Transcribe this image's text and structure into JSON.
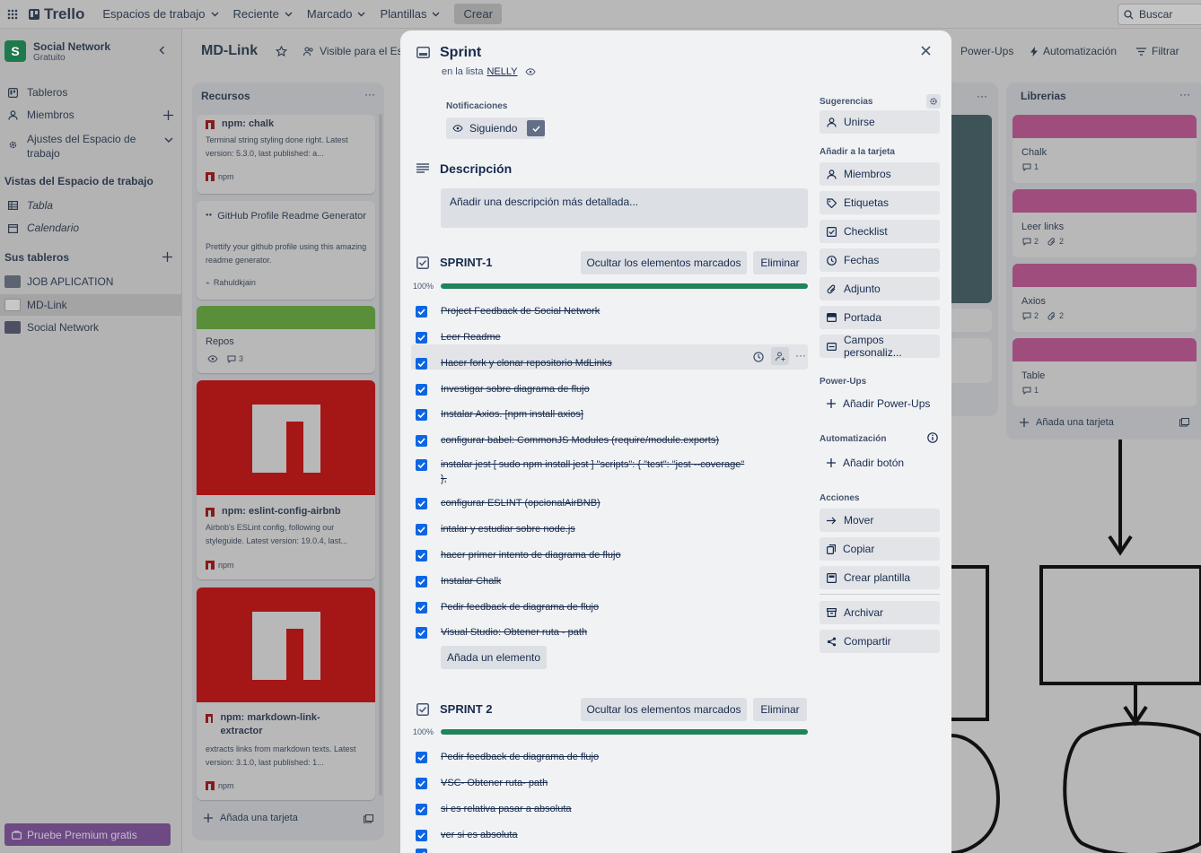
{
  "topbar": {
    "logo": "Trello",
    "nav": [
      "Espacios de trabajo",
      "Reciente",
      "Marcado",
      "Plantillas"
    ],
    "create_label": "Crear",
    "search_placeholder": "Buscar"
  },
  "sidebar": {
    "workspace_name": "Social Network",
    "workspace_plan": "Gratuito",
    "workspace_initial": "S",
    "items": [
      {
        "label": "Tableros",
        "icon": "board-icon"
      },
      {
        "label": "Miembros",
        "icon": "person-icon"
      },
      {
        "label": "Ajustes del Espacio de trabajo",
        "icon": "gear-icon"
      }
    ],
    "views_heading": "Vistas del Espacio de trabajo",
    "views": [
      {
        "label": "Tabla",
        "icon": "table-icon"
      },
      {
        "label": "Calendario",
        "icon": "calendar-icon"
      }
    ],
    "boards_heading": "Sus tableros",
    "boards": [
      "JOB APLICATION",
      "MD-Link",
      "Social Network"
    ],
    "premium_label": "Pruebe Premium gratis"
  },
  "board": {
    "title": "MD-Link",
    "visibility": "Visible para el Esp",
    "powerups": "Power-Ups",
    "automation": "Automatización",
    "filter": "Filtrar"
  },
  "lists": {
    "recursos": {
      "title": "Recursos",
      "chalk": {
        "title": "npm: chalk",
        "desc": "Terminal string styling done right. Latest version: 5.3.0, last published: a...",
        "source": "npm"
      },
      "github": {
        "title": "GitHub Profile Readme Generator",
        "desc": "Prettify your github profile using this amazing readme generator.",
        "author": "Rahuldkjain"
      },
      "repos": {
        "title": "Repos",
        "comments": "3",
        "color": "#5a8f3a"
      },
      "eslint": {
        "title": "npm: eslint-config-airbnb",
        "desc": "Airbnb's ESLint config, following our styleguide. Latest version: 19.0.4, last...",
        "source": "npm"
      },
      "mdlink": {
        "title": "npm: markdown-link-extractor",
        "desc": "extracts links from markdown texts. Latest version: 3.1.0, last published: 1...",
        "source": "npm"
      },
      "add": "Añada una tarjeta"
    },
    "librerias": {
      "title": "Librerias",
      "cards": [
        {
          "title": "Chalk",
          "comments": "1",
          "attachments": ""
        },
        {
          "title": "Leer links",
          "comments": "2",
          "attachments": "2"
        },
        {
          "title": "Axios",
          "comments": "2",
          "attachments": "2"
        },
        {
          "title": "Table",
          "comments": "1",
          "attachments": ""
        }
      ],
      "add": "Añada una tarjeta"
    }
  },
  "modal": {
    "title": "Sprint",
    "list_prefix": "en la lista",
    "list_name": "NELLY",
    "notifications_label": "Notificaciones",
    "following_label": "Siguiendo",
    "description_heading": "Descripción",
    "description_placeholder": "Añadir una descripción más detallada...",
    "checklists": [
      {
        "title": "SPRINT-1",
        "hide_label": "Ocultar los elementos marcados",
        "delete_label": "Eliminar",
        "progress_text": "100%",
        "progress": 1.0,
        "items": [
          "Project Feedback de Social Network",
          "Leer Readme",
          "Hacer fork y clonar repositorio MdLinks",
          "Investigar sobre diagrama de flujo",
          "Instalar Axios. [npm install axios]",
          "configurar babel: CommonJS Modules (require/module.exports)",
          "instalar jest [ sudo npm install jest ] \"scripts\": { \"test\": \"jest --coverage\" },",
          "configurar ESLINT (opcionalAirBNB)",
          "intalar y estudiar sobre node.js",
          "hacer primer intento de diagrama de flujo",
          "Instalar Chalk",
          "Pedir feedback de diagrama de flujo",
          "Visual Studio: Obtener ruta - path"
        ],
        "add_item_label": "Añada un elemento"
      },
      {
        "title": "SPRINT 2",
        "hide_label": "Ocultar los elementos marcados",
        "delete_label": "Eliminar",
        "progress_text": "100%",
        "progress": 1.0,
        "items": [
          "Pedir feedback de diagrama de flujo",
          "VSC- Obtener ruta- path",
          "si es relativa pasar a absoluta",
          "ver si es absoluta"
        ]
      }
    ],
    "side": {
      "suggestions_label": "Sugerencias",
      "join_label": "Unirse",
      "add_to_card_label": "Añadir a la tarjeta",
      "add_buttons": [
        "Miembros",
        "Etiquetas",
        "Checklist",
        "Fechas",
        "Adjunto",
        "Portada",
        "Campos personaliz..."
      ],
      "powerups_label": "Power-Ups",
      "add_powerups": "Añadir Power-Ups",
      "automation_label": "Automatización",
      "add_button": "Añadir botón",
      "actions_label": "Acciones",
      "actions": [
        "Mover",
        "Copiar",
        "Crear plantilla",
        "Archivar",
        "Compartir"
      ]
    }
  },
  "colors": {
    "checkbox": "#0c66e4",
    "progress": "#1f845a",
    "label_pink": "#9e4d7d",
    "npm_red": "#a51616"
  }
}
